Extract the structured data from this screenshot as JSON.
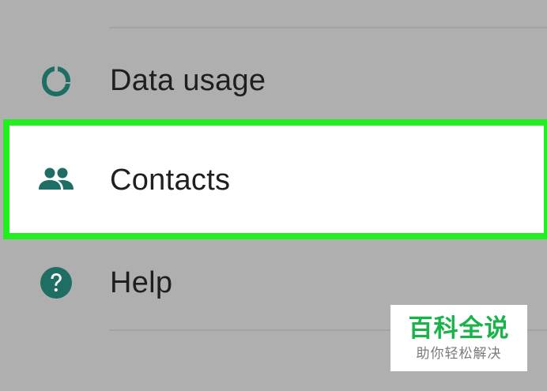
{
  "settings_list": {
    "items": [
      {
        "label": "Data usage",
        "icon": "data-usage-icon"
      },
      {
        "label": "Contacts",
        "icon": "contacts-icon"
      },
      {
        "label": "Help",
        "icon": "help-icon"
      }
    ]
  },
  "watermark": {
    "title": "百科全说",
    "subtitle": "助你轻松解决"
  },
  "colors": {
    "background": "#afafaf",
    "icon_teal": "#1e6e64",
    "highlight_border": "#22ee22",
    "highlight_fill": "#ffffff",
    "watermark_green": "#19b34a"
  }
}
